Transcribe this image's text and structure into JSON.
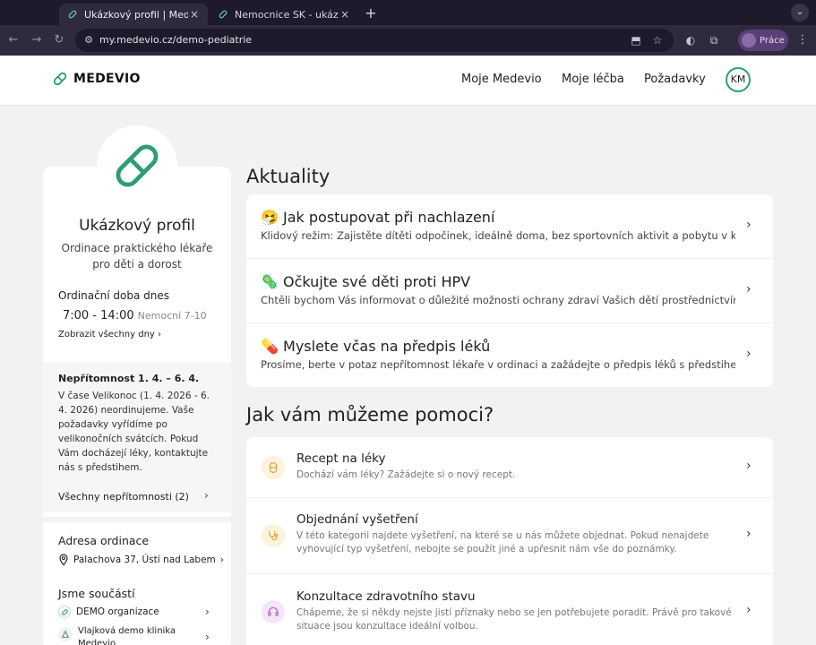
{
  "browser": {
    "tabs": [
      {
        "label": "Ukázkový profil | Medevio",
        "close": "×"
      },
      {
        "label": "Nemocnice SK - ukázkový pr",
        "close": "×"
      }
    ],
    "new_tab": "+",
    "url": "my.medevio.cz/demo-pediatrie",
    "profile_label": "Práce"
  },
  "header": {
    "logo_text": "MEDEVIO",
    "nav": [
      "Moje Medevio",
      "Moje léčba",
      "Požadavky"
    ],
    "avatar_initials": "KM"
  },
  "profile": {
    "name": "Ukázkový profil",
    "subtitle": "Ordinace praktického lékaře pro děti a dorost",
    "hours_heading": "Ordinační doba dnes",
    "hours": "7:00 - 14:00",
    "hours_note": "Nemocní 7-10",
    "show_all_days": "Zobrazit všechny dny",
    "absence": {
      "title": "Nepřítomnost 1. 4. – 6. 4.",
      "text": "V čase Velikonoc (1. 4. 2026 - 6. 4. 2026) neordinujeme. Vaše požadavky vyřídíme po velikonočních svátcích. Pokud Vám docházejí léky, kontaktujte nás s předstihem.",
      "all_link": "Všechny nepřítomnosti (2)"
    },
    "address_heading": "Adresa ordinace",
    "address": "Palachova 37, Ústí nad Labem",
    "member_heading": "Jsme součástí",
    "members": [
      "DEMO organizace",
      "Vlajková demo klinika Medevio"
    ]
  },
  "news": {
    "title": "Aktuality",
    "items": [
      {
        "emoji": "🤧",
        "title": "Jak postupovat při nachlazení",
        "text": "Klidový režim: Zajistěte dítěti odpočinek, ideálně doma, bez sportovních aktivit a pobytu v kolektivu."
      },
      {
        "emoji": "🦠",
        "title": "Očkujte své děti proti HPV",
        "text": "Chtěli bychom Vás informovat o důležité možnosti ochrany zdraví Vašich dětí prostřednictvím očkování."
      },
      {
        "emoji": "💊",
        "title": "Myslete včas na předpis léků",
        "text": "Prosíme, berte v potaz nepřítomnost lékaře v ordinaci a zažádejte o předpis léků s předstihem."
      }
    ]
  },
  "help": {
    "title": "Jak vám můžeme pomoci?",
    "items": [
      {
        "title": "Recept na léky",
        "text": "Dochází vám léky? Zažádejte si o nový recept."
      },
      {
        "title": "Objednání vyšetření",
        "text": "V této kategorii najdete vyšetření, na které se u nás můžete objednat. Pokud nenajdete vyhovující typ vyšetření, nebojte se použít jiné a upřesnit nám vše do poznámky."
      },
      {
        "title": "Konzultace zdravotního stavu",
        "text": "Chápeme, že si někdy nejste jistí příznaky nebo se jen potřebujete poradit. Právě pro takové situace jsou konzultace ideální volbou."
      }
    ]
  },
  "colors": {
    "brand_green": "#2e9d72",
    "recept_icon_bg": "#fcf3dc",
    "vysetreni_icon_bg": "#fcf3dc",
    "konzultace_icon_bg": "#f3e6f7"
  }
}
